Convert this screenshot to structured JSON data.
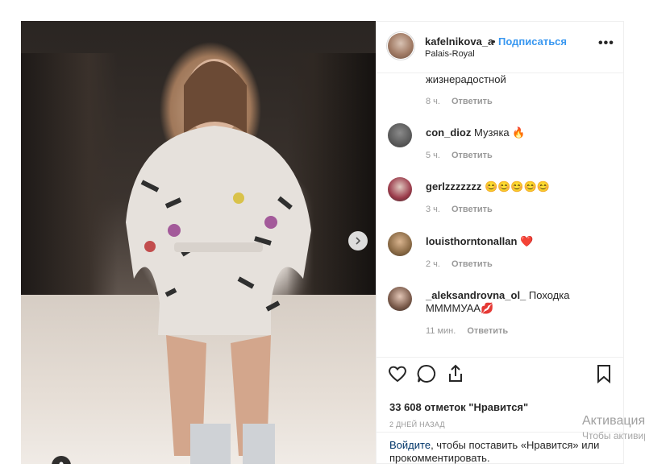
{
  "post": {
    "username": "kafelnikova_a",
    "separator": "•",
    "follow_label": "Подписаться",
    "location": "Palais-Royal",
    "more_label": "•••"
  },
  "comments": {
    "top_fragment": "жизнерадостной",
    "top_meta_time": "8 ч.",
    "reply_label": "Ответить",
    "items": [
      {
        "user": "con_dioz",
        "text": "Музяка 🔥",
        "time": "5 ч."
      },
      {
        "user": "gerlzzzzzzz",
        "text": "😊😊😊😊😊",
        "time": "3 ч."
      },
      {
        "user": "louisthorntonallan",
        "text": "❤️",
        "time": "2 ч."
      },
      {
        "user": "_aleksandrovna_ol_",
        "text": "Походка ММММУАА💋",
        "time": "11 мин."
      }
    ]
  },
  "actions": {
    "likes_text": "33 608 отметок \"Нравится\"",
    "time_ago": "2 ДНЕЙ НАЗАД",
    "login_link": "Войдите",
    "login_rest": ", чтобы поставить «Нравится» или прокомментировать."
  },
  "overlay": {
    "activate_title": "Активация",
    "activate_sub": "Чтобы активировать Windows, перейдите в раздел \"Параметры\""
  },
  "icons": {
    "next": "chevron-right-icon",
    "tag": "user-tag-icon",
    "like": "heart-icon",
    "comment": "comment-icon",
    "share": "share-icon",
    "save": "bookmark-icon"
  },
  "colors": {
    "link": "#3897f0",
    "login_link": "#003569",
    "meta": "#999999",
    "border": "#efefef"
  }
}
